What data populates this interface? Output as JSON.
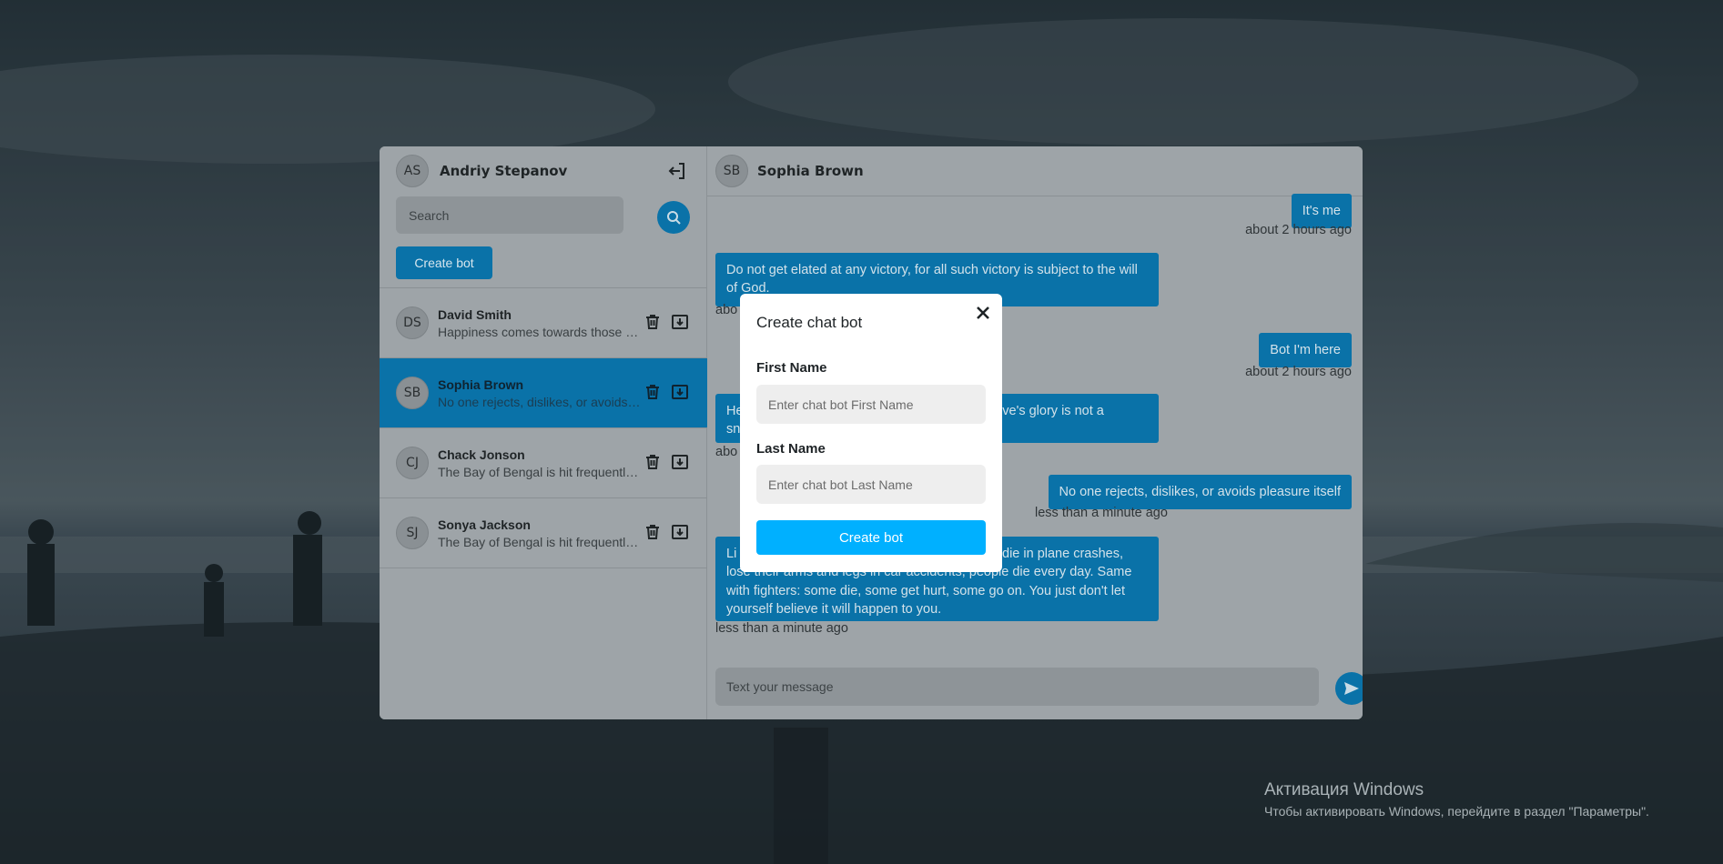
{
  "current_user": {
    "initials": "AS",
    "name": "Andriy Stepanov"
  },
  "search": {
    "placeholder": "Search"
  },
  "create_bot_button_label": "Create bot",
  "conversations": [
    {
      "initials": "DS",
      "name": "David Smith",
      "preview": "Happiness comes towards those who..."
    },
    {
      "initials": "SB",
      "name": "Sophia Brown",
      "preview": "No one rejects, dislikes, or avoids pleasure itself"
    },
    {
      "initials": "CJ",
      "name": "Chack Jonson",
      "preview": "The Bay of Bengal is hit frequently by cyclones"
    },
    {
      "initials": "SJ",
      "name": "Sonya Jackson",
      "preview": "The Bay of Bengal is hit frequently by cyclones"
    }
  ],
  "chat": {
    "contact_initials": "SB",
    "contact_name": "Sophia Brown",
    "messages": [
      {
        "text": "It's me",
        "time": "about 2 hours ago"
      },
      {
        "text": "Do not get elated at any victory, for all such victory is subject to the will of God.",
        "time": "abo"
      },
      {
        "text": "Bot I'm here",
        "time": "about 2 hours ago"
      },
      {
        "text_line1": "He",
        "text_line1_tail": "o. Love's glory is not a",
        "text_line2": "sn",
        "time": "abo"
      },
      {
        "text": "No one rejects, dislikes, or avoids pleasure itself",
        "time": "less than a minute ago"
      },
      {
        "text_line1": "Li",
        "text_line1_tail": "die in plane crashes,",
        "text_line2": "lose their arms and legs in car accidents, people die every day. Same",
        "text_line3": "with fighters: some die, some get hurt, some go on. You just don't let",
        "text_line4": "yourself believe it will happen to you.",
        "time": "less than a minute ago"
      }
    ],
    "input_placeholder": "Text your message"
  },
  "modal": {
    "title": "Create chat bot",
    "first_name_label": "First Name",
    "first_name_placeholder": "Enter chat bot First Name",
    "last_name_label": "Last Name",
    "last_name_placeholder": "Enter chat bot Last Name",
    "submit_label": "Create bot"
  },
  "watermark": {
    "line1": "Активация Windows",
    "line2": "Чтобы активировать Windows, перейдите в раздел \"Параметры\"."
  },
  "colors": {
    "accent": "#0a72a8",
    "modal_button": "#00b0ff"
  },
  "icons": [
    "logout-icon",
    "search-icon",
    "trash-icon",
    "download-icon",
    "send-icon",
    "close-icon"
  ]
}
